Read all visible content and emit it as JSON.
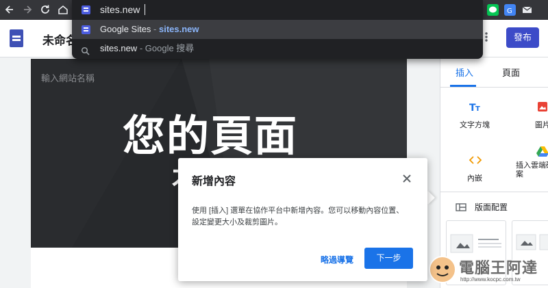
{
  "browser": {
    "address_value": "sites.new",
    "suggestions": [
      {
        "main": "Google Sites",
        "sep": " - ",
        "url": "sites.new",
        "icon": "google-sites-icon"
      },
      {
        "main": "sites.new",
        "sep": " - ",
        "url": "Google 搜尋",
        "icon": "search-icon"
      }
    ],
    "nav_icons": [
      "back-arrow-icon",
      "forward-arrow-icon",
      "reload-icon",
      "home-icon"
    ],
    "ext_icons": [
      "line-extension-icon",
      "translate-extension-icon",
      "mail-extension-icon"
    ]
  },
  "sites": {
    "doc_title_partial": "未命名",
    "publish_label": "發布",
    "site_name_placeholder": "輸入網站名稱",
    "hero_title": "您的頁面",
    "hero_sub_partial": "木"
  },
  "panel": {
    "tabs": [
      "插入",
      "頁面"
    ],
    "active_tab": "插入",
    "tiles": [
      {
        "label": "文字方塊",
        "icon": "text-box-icon"
      },
      {
        "label": "圖片",
        "icon": "image-icon"
      },
      {
        "label": "內嵌",
        "icon": "embed-icon"
      },
      {
        "label": "插入雲端硬碟檔案",
        "icon": "google-drive-icon"
      }
    ],
    "layout_section": "版面配置"
  },
  "dialog": {
    "title": "新增內容",
    "body": "使用 [插入] 選單在協作平台中新增內容。您可以移動內容位置、設定變更大小及裁剪圖片。",
    "skip_label": "略過導覽",
    "next_label": "下一步"
  },
  "watermark": {
    "title": "電腦王阿達",
    "url": "http://www.kocpc.com.tw"
  },
  "colors": {
    "accent": "#1a73e8",
    "publish": "#3c4bc8",
    "sites_brand": "#3f51b5",
    "suggestion_url": "#8ab4f8"
  }
}
